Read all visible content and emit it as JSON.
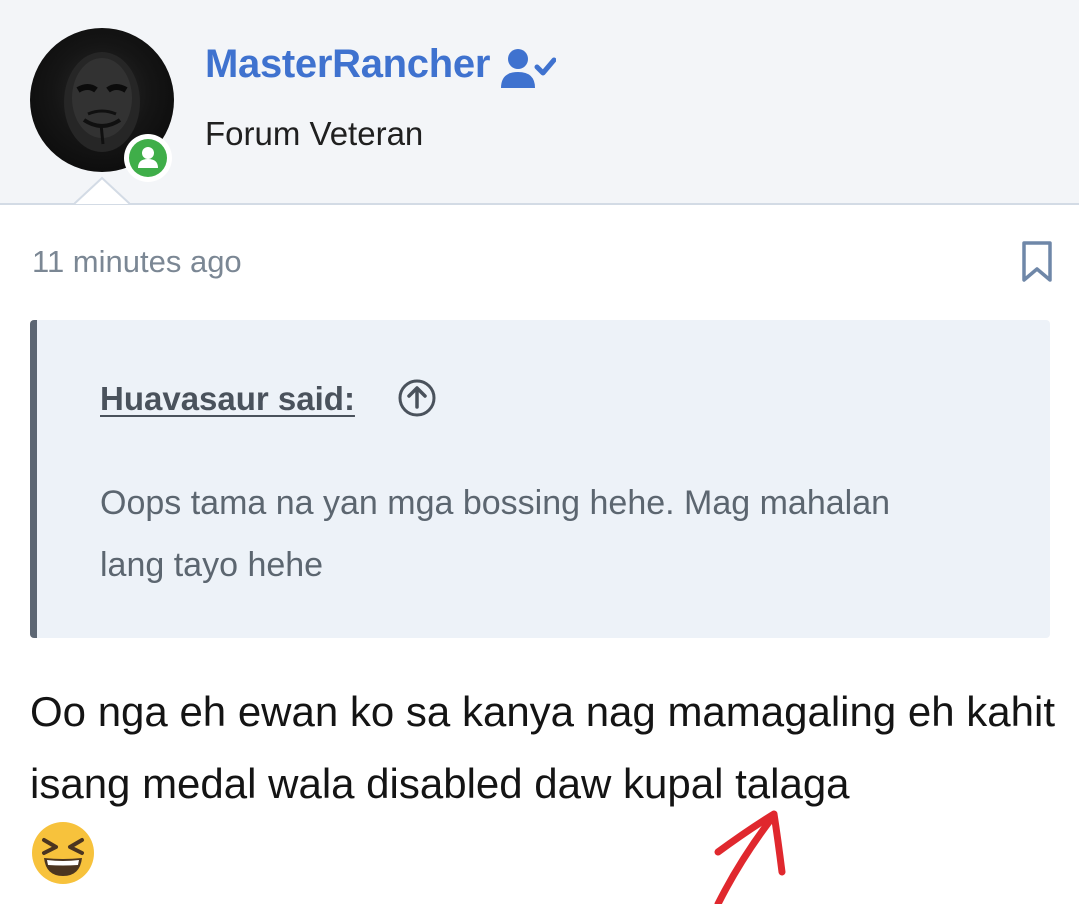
{
  "post": {
    "author": {
      "username": "MasterRancher",
      "title": "Forum Veteran",
      "avatar_icon": "anonymous-mask-avatar",
      "online_status_icon": "online-user-icon",
      "verified_icon": "user-check-icon"
    },
    "timestamp": "11 minutes ago",
    "bookmark_icon": "bookmark-icon",
    "quote": {
      "author_label": "Huavasaur said:",
      "jump_icon": "arrow-up-circle-icon",
      "text": "Oops tama na yan mga bossing hehe. Mag mahalan lang tayo hehe"
    },
    "message": {
      "text": "Oo nga eh ewan ko sa kanya nag mamagaling eh kahit isang medal wala disabled daw kupal talaga",
      "emoji": "grinning-squinting-face-emoji"
    },
    "annotation": {
      "icon": "red-hand-drawn-arrow",
      "color": "#e0282e"
    }
  },
  "colors": {
    "username": "#3f72cf",
    "online": "#3fae49",
    "header_bg": "#f3f5f8",
    "quote_bg": "#edf2f8",
    "quote_border": "#5c6673"
  }
}
